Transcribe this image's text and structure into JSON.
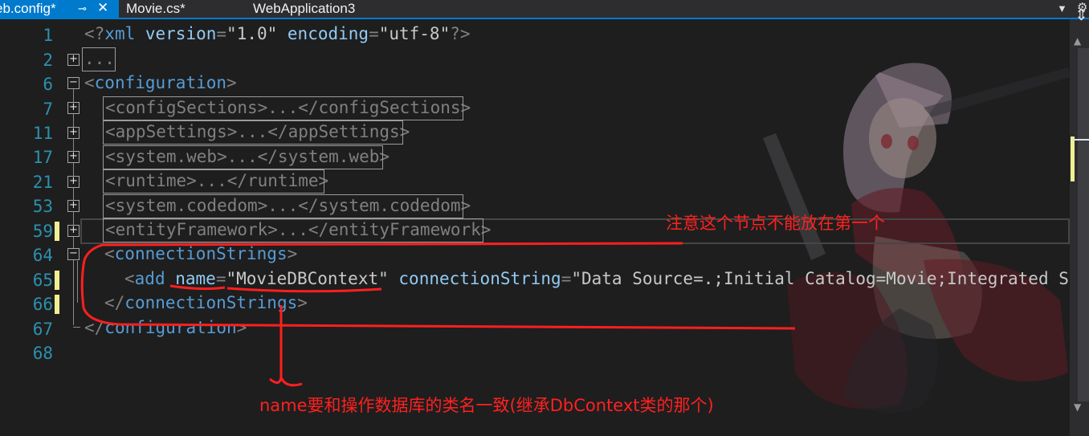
{
  "tabs": {
    "active": {
      "label": "eb.config*",
      "pin": "⊸",
      "close": "✕"
    },
    "movie": {
      "label": "Movie.cs*"
    },
    "project": {
      "label": "WebApplication3"
    },
    "dropdown_icon": "chevron-down-icon",
    "settings_icon": "gear-icon"
  },
  "editor": {
    "line_numbers": [
      "1",
      "2",
      "6",
      "7",
      "11",
      "17",
      "21",
      "53",
      "59",
      "64",
      "65",
      "66",
      "67",
      "68"
    ],
    "lines": {
      "l1": {
        "open": "<?",
        "xml": "xml",
        "version_attr": " version",
        "eq": "=",
        "version_val": "\"1.0\"",
        "encoding_attr": " encoding",
        "encoding_val": "\"utf-8\"",
        "close": "?>"
      },
      "l2": {
        "collapsed": "..."
      },
      "l6": {
        "lt": "<",
        "tag": "configuration",
        "gt": ">"
      },
      "l7": {
        "text": "<configSections>...</configSections>"
      },
      "l11": {
        "text": "<appSettings>...</appSettings>"
      },
      "l17": {
        "text": "<system.web>...</system.web>"
      },
      "l21": {
        "text": "<runtime>...</runtime>"
      },
      "l53": {
        "text": "<system.codedom>...</system.codedom>"
      },
      "l59": {
        "text": "<entityFramework>...</entityFramework>"
      },
      "l64": {
        "lt": "<",
        "tag": "connectionStrings",
        "gt": ">"
      },
      "l65": {
        "lt": "<",
        "tag": "add",
        "name_attr": " name",
        "eq": "=",
        "name_val": "\"MovieDBContext\"",
        "cs_attr": " connectionString",
        "cs_val": "\"Data Source=.;Initial Catalog=Movie;Integrated Security=True\""
      },
      "l66": {
        "lt": "</",
        "tag": "connectionStrings",
        "gt": ">"
      },
      "l67": {
        "lt": "</",
        "tag": "configuration",
        "gt": ">"
      }
    }
  },
  "annotations": {
    "note1": "注意这个节点不能放在第一个",
    "note2": "name要和操作数据库的类名一致(继承DbContext类的那个)",
    "ink_color": "#ff2020"
  },
  "colors": {
    "tab_accent": "#007acc",
    "line_number": "#2b91af",
    "xml_tag": "#569cd6",
    "xml_delimiter": "#808080",
    "xml_attribute": "#92caf4",
    "change_marker": "#efef93"
  },
  "scrollbar": {
    "split_icon": "split-icon",
    "up_icon": "arrow-up-icon",
    "down_icon": "arrow-down-icon"
  }
}
